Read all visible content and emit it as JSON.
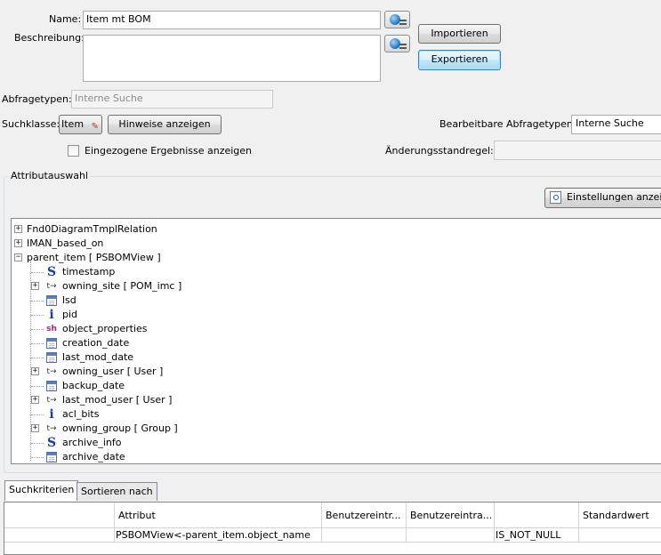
{
  "form": {
    "name_label": "Name:",
    "name_value": "Item mt BOM",
    "description_label": "Beschreibung:",
    "description_value": "",
    "import_button": "Importieren",
    "export_button": "Exportieren",
    "query_types_label": "Abfragetypen:",
    "query_types_value": "Interne Suche",
    "search_class_label": "Suchklasse:",
    "search_class_value": "Item",
    "hints_button": "Hinweise anzeigen",
    "editable_query_types_label": "Bearbeitbare Abfragetypen:",
    "editable_query_types_value": "Interne Suche",
    "show_collapsed_label": "Eingezogene Ergebnisse anzeigen",
    "change_rule_label": "Änderungsstandregel:",
    "change_rule_value": ""
  },
  "attributes": {
    "group_title": "Attributauswahl",
    "settings_button": "Einstellungen anzeig",
    "tree": [
      {
        "label": "Fnd0DiagramTmplRelation",
        "icon": "none",
        "expandable": true,
        "level": 0
      },
      {
        "label": "IMAN_based_on",
        "icon": "none",
        "expandable": true,
        "level": 0
      },
      {
        "label": "parent_item [ PSBOMView ]",
        "icon": "none",
        "expandable": true,
        "expanded": true,
        "level": 0
      },
      {
        "label": "timestamp",
        "icon": "string-icon",
        "expandable": false,
        "level": 1
      },
      {
        "label": "owning_site [ POM_imc ]",
        "icon": "typed-reference-icon",
        "expandable": true,
        "level": 1
      },
      {
        "label": "lsd",
        "icon": "date-icon",
        "expandable": false,
        "level": 1
      },
      {
        "label": "pid",
        "icon": "integer-icon",
        "expandable": false,
        "level": 1
      },
      {
        "label": "object_properties",
        "icon": "short-icon",
        "expandable": false,
        "level": 1
      },
      {
        "label": "creation_date",
        "icon": "date-icon",
        "expandable": false,
        "level": 1
      },
      {
        "label": "last_mod_date",
        "icon": "date-icon",
        "expandable": false,
        "level": 1
      },
      {
        "label": "owning_user [ User ]",
        "icon": "typed-reference-icon",
        "expandable": true,
        "level": 1
      },
      {
        "label": "backup_date",
        "icon": "date-icon",
        "expandable": false,
        "level": 1
      },
      {
        "label": "last_mod_user [ User ]",
        "icon": "typed-reference-icon",
        "expandable": true,
        "level": 1
      },
      {
        "label": "acl_bits",
        "icon": "integer-icon",
        "expandable": false,
        "level": 1
      },
      {
        "label": "owning_group [ Group ]",
        "icon": "typed-reference-icon",
        "expandable": true,
        "level": 1
      },
      {
        "label": "archive_info",
        "icon": "string-icon",
        "expandable": false,
        "level": 1
      },
      {
        "label": "archive_date",
        "icon": "date-icon",
        "expandable": false,
        "level": 1
      }
    ]
  },
  "tabs": [
    {
      "label": "Suchkriterien",
      "active": true
    },
    {
      "label": "Sortieren nach",
      "active": false
    }
  ],
  "criteria_table": {
    "headers": [
      "",
      "Attribut",
      "Benutzereintr...",
      "Benutzereintra...",
      "",
      "Standardwert"
    ],
    "rows": [
      [
        "",
        "PSBOMView<-parent_item.object_name",
        "",
        "",
        "IS_NOT_NULL",
        ""
      ]
    ]
  }
}
